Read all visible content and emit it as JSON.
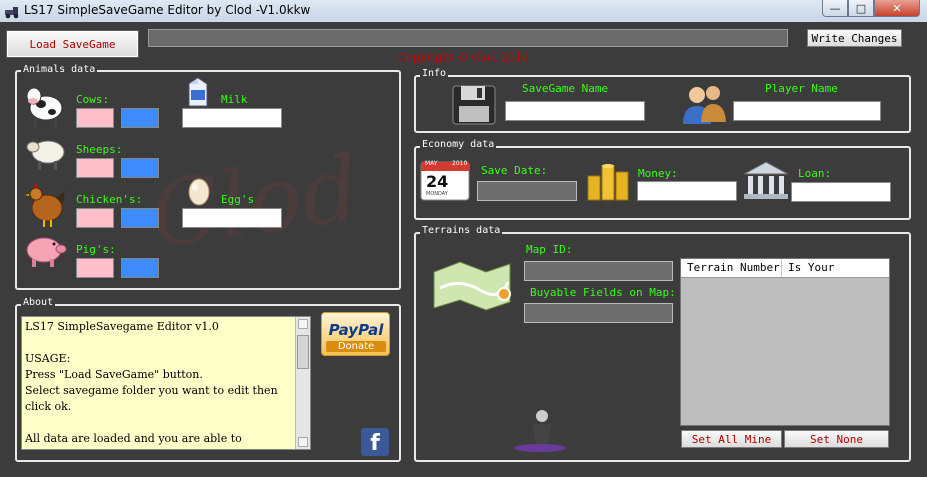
{
  "window": {
    "title": "LS17 SimpleSaveGame Editor by Clod -V1.0kkw"
  },
  "toolbar": {
    "load_label": "Load SaveGame",
    "write_label": "Write Changes"
  },
  "copyright": "Copyright © Clod 2016",
  "watermark": "Clod",
  "animals": {
    "title": "Animals data",
    "cows": "Cows:",
    "sheeps": "Sheeps:",
    "chickens": "Chicken's:",
    "pigs": "Pig's:",
    "milk": "Milk",
    "eggs": "Egg's"
  },
  "info": {
    "title": "Info",
    "savegame_name": "SaveGame Name",
    "player_name": "Player Name"
  },
  "economy": {
    "title": "Economy data",
    "save_date": "Save Date:",
    "money": "Money:",
    "loan": "Loan:",
    "calendar_month": "MAY",
    "calendar_day": "24",
    "calendar_year": "2010",
    "calendar_weekday": "MONDAY"
  },
  "terrains": {
    "title": "Terrains data",
    "map_id": "Map ID:",
    "buyable": "Buyable Fields on Map:",
    "columns": [
      "Terrain Number",
      "Is Your"
    ],
    "set_all": "Set All Mine",
    "set_none": "Set None"
  },
  "about": {
    "title": "About",
    "text": "LS17 SimpleSavegame Editor v1.0\n\nUSAGE:\nPress \"Load SaveGame\" button.\nSelect savegame folder you want to edit then click ok.\n\nAll data are loaded and you are able to",
    "paypal": "PayPal",
    "donate": "Donate",
    "facebook": "f"
  },
  "colors": {
    "label_green": "#39ff14",
    "pink_box": "#ffc0cb",
    "blue_box": "#3d8bff",
    "copyright_red": "#d60000"
  }
}
